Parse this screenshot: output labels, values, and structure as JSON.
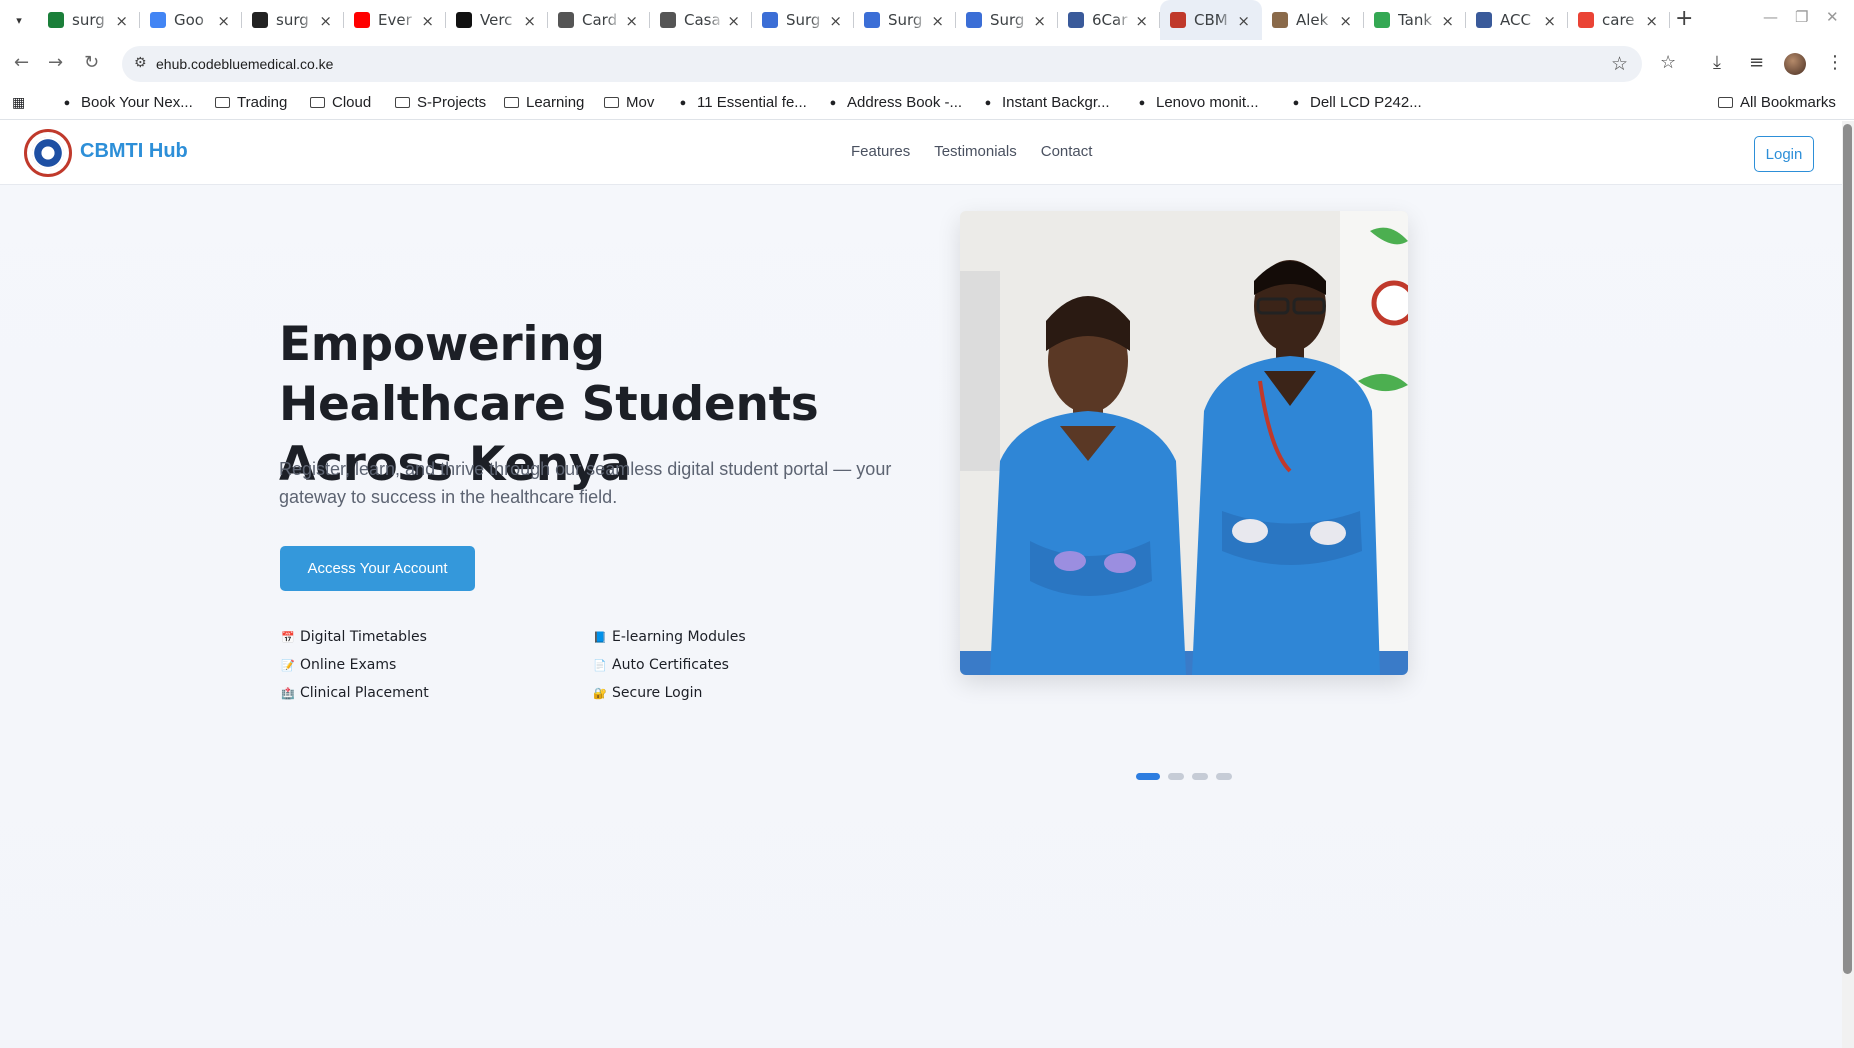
{
  "browser": {
    "tabs": [
      {
        "title": "surg",
        "favicon_color": "#1b7f3a"
      },
      {
        "title": "Goo",
        "favicon_color": "#4285f4"
      },
      {
        "title": "surg",
        "favicon_color": "#222222"
      },
      {
        "title": "Ever",
        "favicon_color": "#ff0000"
      },
      {
        "title": "Verc",
        "favicon_color": "#111111"
      },
      {
        "title": "Card",
        "favicon_color": "#555555"
      },
      {
        "title": "Casa",
        "favicon_color": "#555555"
      },
      {
        "title": "Surg",
        "favicon_color": "#3b6ed6"
      },
      {
        "title": "Surg",
        "favicon_color": "#3b6ed6"
      },
      {
        "title": "Surg",
        "favicon_color": "#3b6ed6"
      },
      {
        "title": "6Car",
        "favicon_color": "#3a5a9a"
      },
      {
        "title": "CBM",
        "favicon_color": "#c0392b",
        "active": true
      },
      {
        "title": "Alek",
        "favicon_color": "#8a6a4a"
      },
      {
        "title": "Tank",
        "favicon_color": "#34a853"
      },
      {
        "title": "ACC",
        "favicon_color": "#3a5a9a"
      },
      {
        "title": "care",
        "favicon_color": "#ea4335"
      }
    ],
    "url": "ehub.codebluemedical.co.ke",
    "bookmarks": [
      {
        "label": "Book Your Nex...",
        "icon": "v-brand-icon"
      },
      {
        "label": "Trading",
        "icon": "folder-icon"
      },
      {
        "label": "Cloud",
        "icon": "folder-icon"
      },
      {
        "label": "S-Projects",
        "icon": "folder-icon"
      },
      {
        "label": "Learning",
        "icon": "folder-icon"
      },
      {
        "label": "Mov",
        "icon": "folder-icon"
      },
      {
        "label": "11 Essential fe...",
        "icon": "site-icon"
      },
      {
        "label": "Address Book -...",
        "icon": "globe-icon"
      },
      {
        "label": "Instant Backgr...",
        "icon": "site-icon"
      },
      {
        "label": "Lenovo monit...",
        "icon": "site-icon"
      },
      {
        "label": "Dell LCD P242...",
        "icon": "fg-icon"
      }
    ],
    "all_bookmarks": "All Bookmarks"
  },
  "site": {
    "brand": "CBMTI Hub",
    "nav": [
      "Features",
      "Testimonials",
      "Contact"
    ],
    "login": "Login",
    "hero_title": "Empowering Healthcare Students Across Kenya",
    "hero_subtitle": "Register, learn, and thrive through our seamless digital student portal — your gateway to success in the healthcare field.",
    "cta": "Access Your Account",
    "features": [
      {
        "emoji": "📅",
        "label": "Digital Timetables"
      },
      {
        "emoji": "📘",
        "label": "E-learning Modules"
      },
      {
        "emoji": "📝",
        "label": "Online Exams"
      },
      {
        "emoji": "📄",
        "label": "Auto Certificates"
      },
      {
        "emoji": "🏥",
        "label": "Clinical Placement"
      },
      {
        "emoji": "🔐",
        "label": "Secure Login"
      }
    ],
    "carousel": {
      "slides": 4,
      "active": 0
    },
    "accent_color": "#3498db"
  }
}
